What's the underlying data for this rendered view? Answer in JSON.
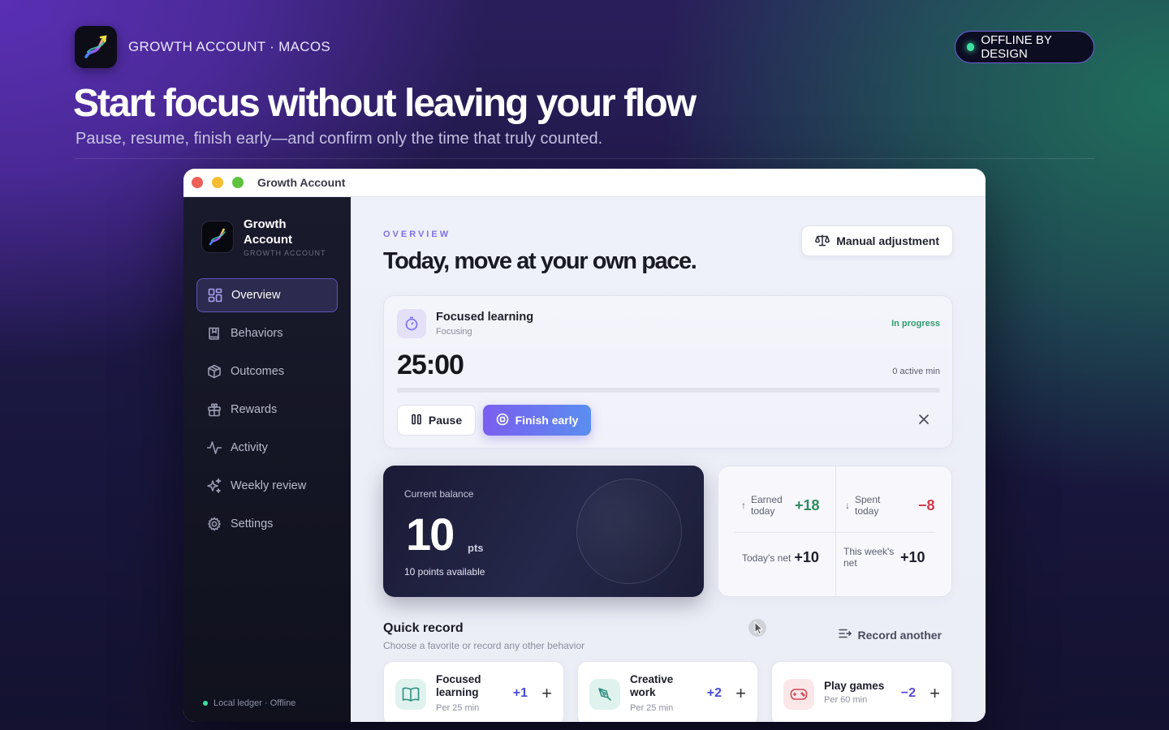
{
  "header": {
    "brand": "GROWTH ACCOUNT · MACOS",
    "offline_badge": "OFFLINE BY DESIGN",
    "title": "Start focus without leaving your flow",
    "subtitle": "Pause, resume, finish early—and confirm only the time that truly counted."
  },
  "window": {
    "title": "Growth Account",
    "traffic_colors": [
      "#ee5f57",
      "#f5bd2f",
      "#5fc23f"
    ]
  },
  "sidebar": {
    "brand_name": "Growth Account",
    "brand_caption": "GROWTH ACCOUNT",
    "items": [
      {
        "label": "Overview",
        "icon": "grid-icon",
        "active": true
      },
      {
        "label": "Behaviors",
        "icon": "book-icon",
        "active": false
      },
      {
        "label": "Outcomes",
        "icon": "cube-icon",
        "active": false
      },
      {
        "label": "Rewards",
        "icon": "gift-icon",
        "active": false
      },
      {
        "label": "Activity",
        "icon": "pulse-icon",
        "active": false
      },
      {
        "label": "Weekly review",
        "icon": "sparkles-icon",
        "active": false
      },
      {
        "label": "Settings",
        "icon": "gear-icon",
        "active": false
      }
    ],
    "footer": "Local ledger · Offline"
  },
  "main": {
    "eyebrow": "OVERVIEW",
    "title": "Today, move at your own pace.",
    "manual_button": "Manual adjustment",
    "focus": {
      "title": "Focused learning",
      "subtitle": "Focusing",
      "status": "In progress",
      "timer": "25:00",
      "active": "0 active min",
      "progress": 0,
      "pause_label": "Pause",
      "finish_label": "Finish early"
    },
    "balance": {
      "label": "Current balance",
      "value": "10",
      "unit": "pts",
      "note": "10 points available"
    },
    "stats": {
      "earned_label": "Earned today",
      "earned_value": "+18",
      "spent_label": "Spent today",
      "spent_value": "−8",
      "net_label": "Today's net",
      "net_value": "+10",
      "week_label": "This week's net",
      "week_value": "+10"
    },
    "quick_record": {
      "title": "Quick record",
      "subtitle": "Choose a favorite or record any other behavior",
      "link": "Record another",
      "cards": [
        {
          "name": "Focused learning",
          "meta": "Per 25 min",
          "points": "+1",
          "icon": "book-open-icon",
          "color": "#4a4cd8"
        },
        {
          "name": "Creative work",
          "meta": "Per 25 min",
          "points": "+2",
          "icon": "pen-tool-icon",
          "color": "#4a4cd8"
        },
        {
          "name": "Play games",
          "meta": "Per 60 min",
          "points": "−2",
          "icon": "gamepad-icon",
          "color": "#5a4ad8"
        }
      ]
    }
  },
  "colors": {
    "accent": "#7b6cf0",
    "positive": "#2f8a5f",
    "negative": "#d03a4a"
  }
}
